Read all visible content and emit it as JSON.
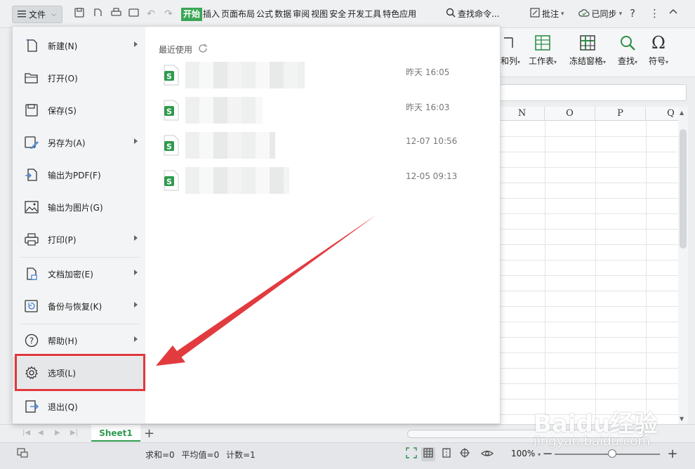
{
  "toolbar": {
    "file_label": "文件",
    "tabs": [
      {
        "label": "开始",
        "active": true
      },
      {
        "label": "插入",
        "active": false
      },
      {
        "label": "页面布局",
        "active": false
      },
      {
        "label": "公式",
        "active": false
      },
      {
        "label": "数据",
        "active": false
      },
      {
        "label": "审阅",
        "active": false
      },
      {
        "label": "视图",
        "active": false
      },
      {
        "label": "安全",
        "active": false
      },
      {
        "label": "开发工具",
        "active": false
      },
      {
        "label": "特色应用",
        "active": false
      }
    ],
    "search_label": "查找命令...",
    "annotate_label": "批注",
    "sync_label": "已同步",
    "accent_color": "#3aa655"
  },
  "ribbon": {
    "items": [
      {
        "label": "和列",
        "icon": "column-icon"
      },
      {
        "label": "工作表",
        "icon": "worksheet-icon"
      },
      {
        "label": "冻结窗格",
        "icon": "freeze-pane-icon"
      },
      {
        "label": "查找",
        "icon": "find-icon"
      },
      {
        "label": "符号",
        "icon": "omega-icon"
      }
    ]
  },
  "grid": {
    "columns": [
      "N",
      "O",
      "P",
      "Q"
    ]
  },
  "file_menu": {
    "items": [
      {
        "label": "新建(N)",
        "icon": "new-file-icon",
        "has_submenu": true
      },
      {
        "label": "打开(O)",
        "icon": "folder-open-icon",
        "has_submenu": false
      },
      {
        "label": "保存(S)",
        "icon": "save-icon",
        "has_submenu": false
      },
      {
        "label": "另存为(A)",
        "icon": "save-as-icon",
        "has_submenu": true
      },
      {
        "label": "输出为PDF(F)",
        "icon": "export-pdf-icon",
        "has_submenu": false
      },
      {
        "label": "输出为图片(G)",
        "icon": "export-image-icon",
        "has_submenu": false
      },
      {
        "label": "打印(P)",
        "icon": "print-icon",
        "has_submenu": true
      },
      {
        "label": "文档加密(E)",
        "icon": "encrypt-icon",
        "has_submenu": true
      },
      {
        "label": "备份与恢复(K)",
        "icon": "backup-icon",
        "has_submenu": true
      },
      {
        "label": "帮助(H)",
        "icon": "help-icon",
        "has_submenu": true
      },
      {
        "label": "选项(L)",
        "icon": "gear-icon",
        "has_submenu": false,
        "highlighted": true
      },
      {
        "label": "退出(Q)",
        "icon": "exit-icon",
        "has_submenu": false
      }
    ],
    "recent_title": "最近使用",
    "recent_files": [
      {
        "time": "昨天 16:05"
      },
      {
        "time": "昨天 16:03"
      },
      {
        "time": "12-07 10:56"
      },
      {
        "time": "12-05 09:13"
      }
    ],
    "highlight_color": "#e0383e"
  },
  "sheets": {
    "tabs": [
      "Sheet1"
    ]
  },
  "status": {
    "sum_label": "求和=0",
    "avg_label": "平均值=0",
    "count_label": "计数=1",
    "zoom": "100%"
  },
  "watermark": {
    "line1": "Baidu经验",
    "line2": "jingyan.baidu.com"
  }
}
